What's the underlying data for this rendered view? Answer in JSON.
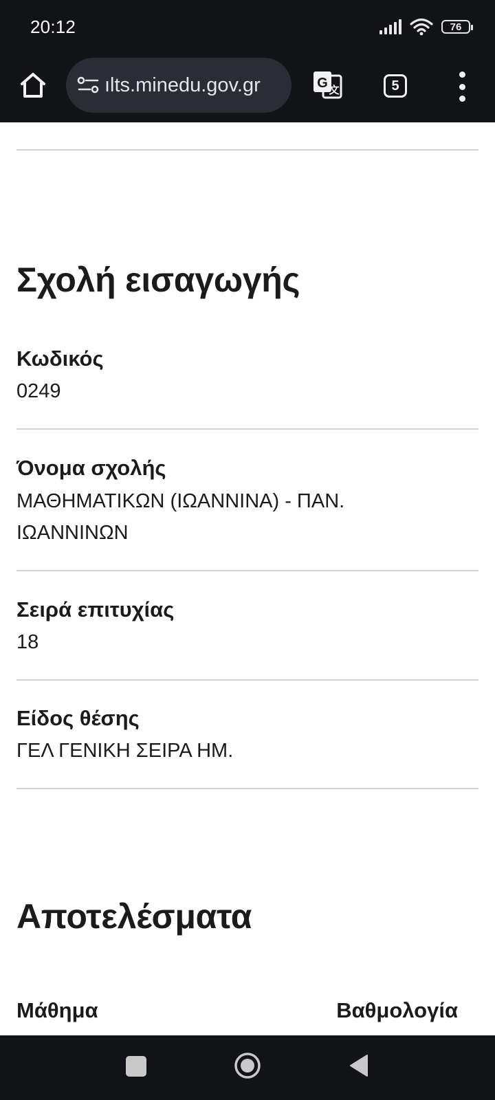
{
  "status_bar": {
    "time": "20:12",
    "battery": "76"
  },
  "browser": {
    "url": "ılts.minedu.gov.gr",
    "tab_count": "5"
  },
  "school_section": {
    "title": "Σχολή εισαγωγής",
    "fields": [
      {
        "label": "Κωδικός",
        "value": "0249"
      },
      {
        "label": "Όνομα σχολής",
        "value_line1": "ΜΑΘΗΜΑΤΙΚΩΝ (ΙΩΑΝΝΙΝΑ) - ΠΑΝ.",
        "value_line2": "ΙΩΑΝΝΙΝΩΝ"
      },
      {
        "label": "Σειρά επιτυχίας",
        "value": "18"
      },
      {
        "label": "Είδος θέσης",
        "value": "ΓΕΛ ΓΕΝΙΚΗ ΣΕΙΡΑ ΗΜ."
      }
    ]
  },
  "results_section": {
    "title": "Αποτελέσματα",
    "columns": [
      "Μάθημα",
      "Βαθμολογία"
    ]
  }
}
